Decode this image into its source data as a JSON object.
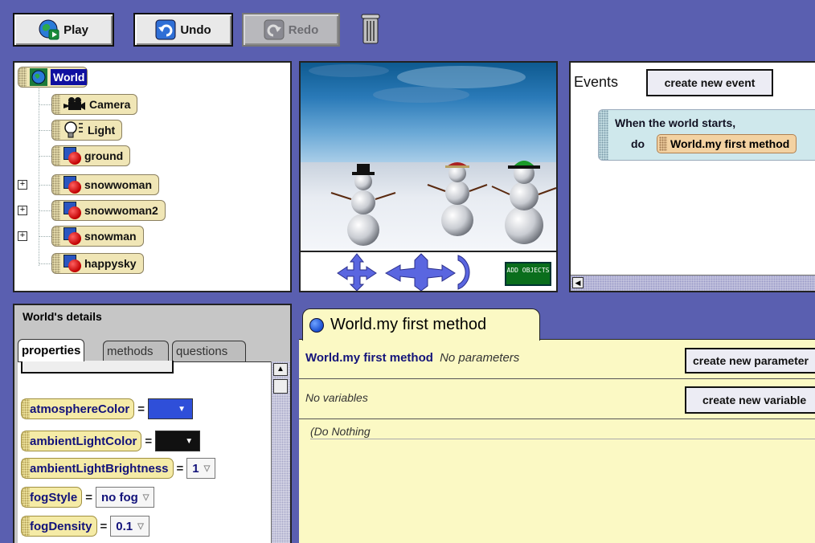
{
  "toolbar": {
    "play_label": "Play",
    "undo_label": "Undo",
    "redo_label": "Redo"
  },
  "tree": {
    "root_label": "World",
    "items": [
      {
        "label": "Camera",
        "icon": "camera-icon",
        "expandable": false
      },
      {
        "label": "Light",
        "icon": "light-bulb-icon",
        "expandable": false
      },
      {
        "label": "ground",
        "icon": "object-icon",
        "expandable": false
      },
      {
        "label": "snowwoman",
        "icon": "object-icon",
        "expandable": true
      },
      {
        "label": "snowwoman2",
        "icon": "object-icon",
        "expandable": true
      },
      {
        "label": "snowman",
        "icon": "object-icon",
        "expandable": true
      },
      {
        "label": "happysky",
        "icon": "object-icon",
        "expandable": false
      }
    ]
  },
  "scene": {
    "add_objects_label": "ADD OBJECTS"
  },
  "events": {
    "title": "Events",
    "create_event_label": "create new event",
    "event_when": "When the world starts,",
    "event_do": "do",
    "event_method": "World.my first method"
  },
  "details": {
    "title": "World's details",
    "tabs": [
      "properties",
      "methods",
      "questions"
    ],
    "active_tab": "properties",
    "properties": [
      {
        "name": "atmosphereColor",
        "type": "color",
        "color": "#2f4fd9"
      },
      {
        "name": "ambientLightColor",
        "type": "color",
        "color": "#111111"
      },
      {
        "name": "ambientLightBrightness",
        "type": "value",
        "value": "1"
      },
      {
        "name": "fogStyle",
        "type": "value",
        "value": "no fog"
      },
      {
        "name": "fogDensity",
        "type": "value",
        "value": "0.1"
      }
    ]
  },
  "editor": {
    "tab_label": "World.my first method",
    "header_name": "World.my first method",
    "no_parameters": "No parameters",
    "create_param_label": "create new parameter",
    "no_variables": "No variables",
    "create_var_label": "create new variable",
    "do_nothing": "(Do Nothing"
  },
  "colors": {
    "background": "#5a5fb0",
    "editor_bg": "#fbf9c4",
    "tile_bg": "#f0e6b6",
    "property_tile_bg": "#f5eba6",
    "event_bg": "#cfe8ec",
    "method_tile_bg": "#f3d2a2",
    "add_objects_bg": "#0a6e1c"
  }
}
